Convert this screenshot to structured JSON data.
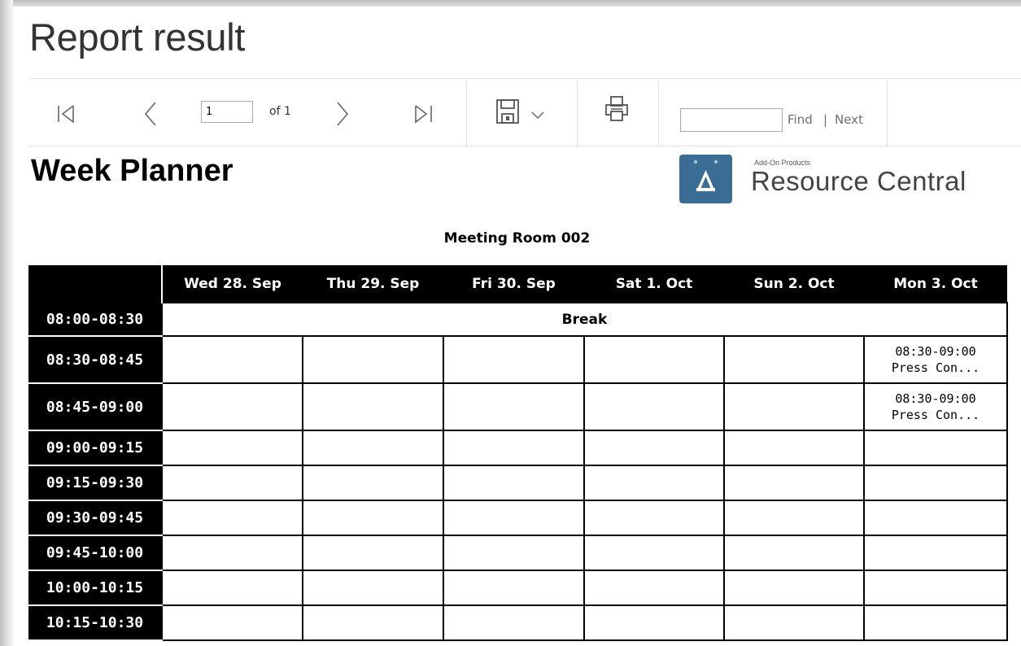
{
  "page_title": "Report result",
  "toolbar": {
    "first_page_icon": "first-page-icon",
    "previous_page_icon": "previous-page-icon",
    "current_page": "1",
    "page_count_label": "of 1",
    "next_page_icon": "next-page-icon",
    "last_page_icon": "last-page-icon",
    "save_icon": "save-icon",
    "save_dropdown_icon": "chevron-down-icon",
    "print_icon": "print-icon",
    "find_value": "",
    "find_label": "Find",
    "separator": "|",
    "next_label": "Next"
  },
  "report": {
    "title": "Week Planner",
    "logo": {
      "small_text": "Add-On Products",
      "brand_text": "Resource Central",
      "icon": "resource-central-logo-icon",
      "color": "#3a6d93"
    },
    "room": "Meeting Room 002",
    "days": [
      "Wed 28. Sep",
      "Thu 29. Sep",
      "Fri 30. Sep",
      "Sat 1. Oct",
      "Sun 2. Oct",
      "Mon 3. Oct"
    ],
    "rows": [
      {
        "time": "08:00-08:30",
        "break_label": "Break"
      },
      {
        "time": "08:30-08:45",
        "event_time": "08:30-09:00",
        "event_title": "Press Con..."
      },
      {
        "time": "08:45-09:00",
        "event_time": "08:30-09:00",
        "event_title": "Press Con..."
      },
      {
        "time": "09:00-09:15"
      },
      {
        "time": "09:15-09:30"
      },
      {
        "time": "09:30-09:45"
      },
      {
        "time": "09:45-10:00"
      },
      {
        "time": "10:00-10:15"
      },
      {
        "time": "10:15-10:30"
      }
    ]
  }
}
